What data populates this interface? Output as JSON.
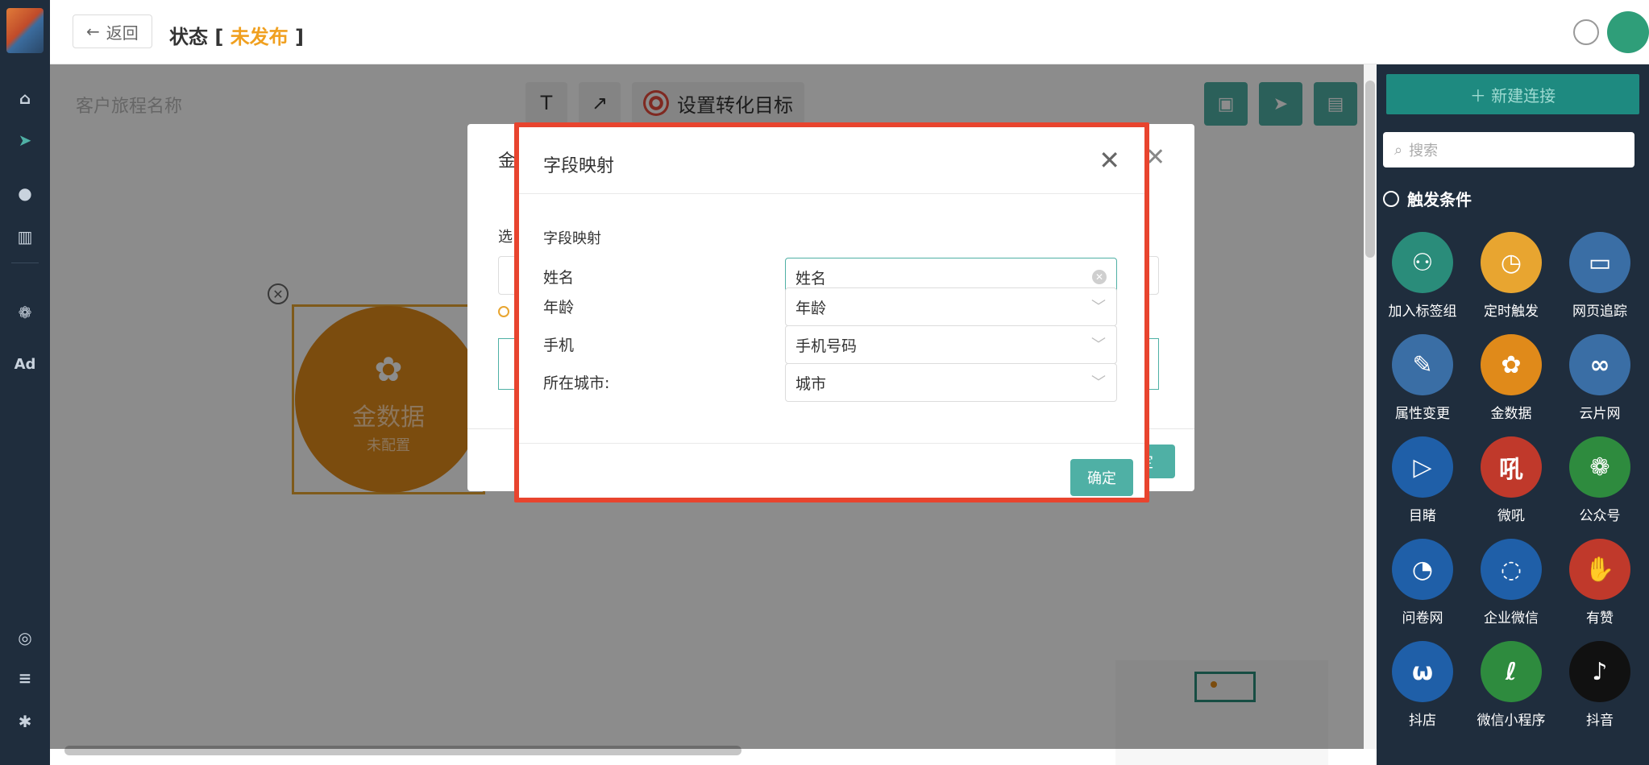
{
  "topbar": {
    "back_label": "返回",
    "status_label": "状态",
    "status_value": "未发布"
  },
  "canvas": {
    "journey_name_placeholder": "客户旅程名称",
    "text_tool": "T",
    "arrow_tool": "↗",
    "goal_button": "设置转化目标",
    "node": {
      "name": "金数据",
      "status": "未配置"
    }
  },
  "right_panel": {
    "new_connection": "新建连接",
    "search_placeholder": "搜索",
    "section_title": "触发条件",
    "items": [
      {
        "label": "加入标签组",
        "icon": "user-plus-icon",
        "color": "#2a8c7a"
      },
      {
        "label": "定时触发",
        "icon": "clock-icon",
        "color": "#e8a530"
      },
      {
        "label": "网页追踪",
        "icon": "web-page-icon",
        "color": "#3a6ea5"
      },
      {
        "label": "属性变更",
        "icon": "edit-icon",
        "color": "#3a6ea5"
      },
      {
        "label": "金数据",
        "icon": "jinshuju-icon",
        "color": "#e08a1a"
      },
      {
        "label": "云片网",
        "icon": "yunpian-icon",
        "color": "#3a6ea5"
      },
      {
        "label": "目睹",
        "icon": "play-icon",
        "color": "#1f5fa8"
      },
      {
        "label": "微吼",
        "icon": "vhall-icon",
        "color": "#c0392b"
      },
      {
        "label": "公众号",
        "icon": "wechat-icon",
        "color": "#2e8b3e"
      },
      {
        "label": "问卷网",
        "icon": "wenjuan-icon",
        "color": "#1f5fa8"
      },
      {
        "label": "企业微信",
        "icon": "work-wechat-icon",
        "color": "#1f5fa8"
      },
      {
        "label": "有赞",
        "icon": "youzan-icon",
        "color": "#c0392b"
      },
      {
        "label": "抖店",
        "icon": "doudian-icon",
        "color": "#1f5fa8"
      },
      {
        "label": "微信小程序",
        "icon": "mini-program-icon",
        "color": "#2e8b3e"
      },
      {
        "label": "抖音",
        "icon": "douyin-icon",
        "color": "#111111"
      }
    ]
  },
  "back_dialog": {
    "title_fragment": "金",
    "select_fragment": "选",
    "confirm_fragment": "定"
  },
  "mapping_dialog": {
    "title": "字段映射",
    "section": "字段映射",
    "rows": [
      {
        "label": "姓名",
        "value": "姓名"
      },
      {
        "label": "年龄",
        "value": "年龄"
      },
      {
        "label": "手机",
        "value": "手机号码"
      },
      {
        "label": "所在城市:",
        "value": "城市"
      }
    ],
    "confirm": "确定"
  },
  "colors": {
    "accent": "#4fb0a5",
    "highlight_border": "#e8442e",
    "node": "#e08a1a",
    "status_value": "#f0a020"
  }
}
